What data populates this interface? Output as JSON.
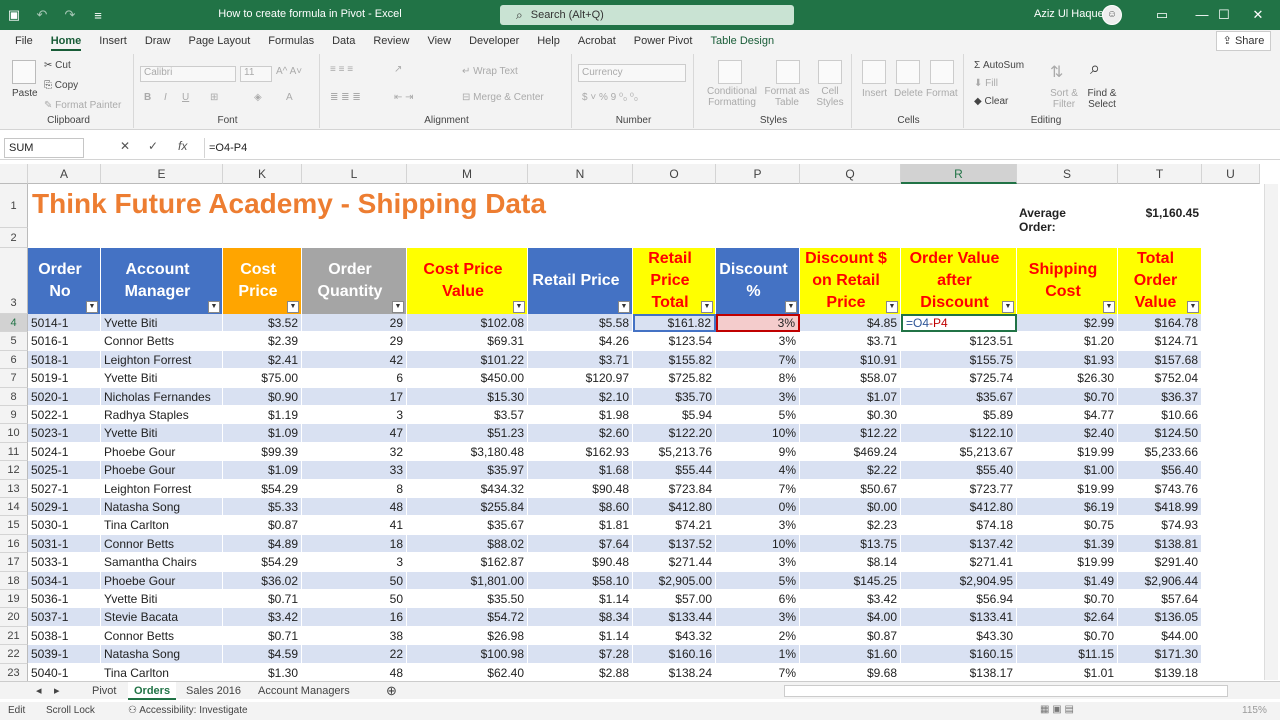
{
  "app": {
    "doc_title": "How to create formula in Pivot  -  Excel",
    "search_placeholder": "Search (Alt+Q)",
    "user_name": "Aziz Ul Haque",
    "share_label": "Share"
  },
  "menu": [
    "File",
    "Home",
    "Insert",
    "Draw",
    "Page Layout",
    "Formulas",
    "Data",
    "Review",
    "View",
    "Developer",
    "Help",
    "Acrobat",
    "Power Pivot",
    "Table Design"
  ],
  "ribbon": {
    "paste": "Paste",
    "cut": "Cut",
    "copy": "Copy",
    "format_painter": "Format Painter",
    "clipboard": "Clipboard",
    "font_name": "Calibri",
    "font_size": "11",
    "font": "Font",
    "wrap_text": "Wrap Text",
    "merge_center": "Merge & Center",
    "alignment": "Alignment",
    "number_format": "Currency",
    "number": "Number",
    "cond_fmt": "Conditional Formatting",
    "format_table": "Format as Table",
    "cell_styles": "Cell Styles",
    "styles": "Styles",
    "insert": "Insert",
    "delete": "Delete",
    "format": "Format",
    "cells": "Cells",
    "autosum": "AutoSum",
    "fill": "Fill",
    "clear": "Clear",
    "sort_filter": "Sort & Filter",
    "find_select": "Find & Select",
    "editing": "Editing"
  },
  "formula_bar": {
    "name_box": "SUM",
    "formula": "=O4-P4"
  },
  "columns": [
    "A",
    "E",
    "K",
    "L",
    "M",
    "N",
    "O",
    "P",
    "Q",
    "R",
    "S",
    "T",
    "U"
  ],
  "sheet": {
    "title": "Think Future Academy - Shipping Data",
    "avg_label": "Average Order:",
    "avg_value": "$1,160.45",
    "headers": [
      "Order No",
      "Account Manager",
      "Cost Price",
      "Order Quantity",
      "Cost Price Value",
      "Retail Price",
      "Retail Price Total",
      "Discount %",
      "Discount $ on Retail Price",
      "Order Value after Discount",
      "Shipping Cost",
      "Total Order Value"
    ],
    "editing_cell": "=O4-P4",
    "rows": [
      [
        "5014-1",
        "Yvette Biti",
        "$3.52",
        "29",
        "$102.08",
        "$5.58",
        "$161.82",
        "3%",
        "$4.85",
        "",
        "$2.99",
        "$164.78"
      ],
      [
        "5016-1",
        "Connor Betts",
        "$2.39",
        "29",
        "$69.31",
        "$4.26",
        "$123.54",
        "3%",
        "$3.71",
        "$123.51",
        "$1.20",
        "$124.71"
      ],
      [
        "5018-1",
        "Leighton Forrest",
        "$2.41",
        "42",
        "$101.22",
        "$3.71",
        "$155.82",
        "7%",
        "$10.91",
        "$155.75",
        "$1.93",
        "$157.68"
      ],
      [
        "5019-1",
        "Yvette Biti",
        "$75.00",
        "6",
        "$450.00",
        "$120.97",
        "$725.82",
        "8%",
        "$58.07",
        "$725.74",
        "$26.30",
        "$752.04"
      ],
      [
        "5020-1",
        "Nicholas Fernandes",
        "$0.90",
        "17",
        "$15.30",
        "$2.10",
        "$35.70",
        "3%",
        "$1.07",
        "$35.67",
        "$0.70",
        "$36.37"
      ],
      [
        "5022-1",
        "Radhya Staples",
        "$1.19",
        "3",
        "$3.57",
        "$1.98",
        "$5.94",
        "5%",
        "$0.30",
        "$5.89",
        "$4.77",
        "$10.66"
      ],
      [
        "5023-1",
        "Yvette Biti",
        "$1.09",
        "47",
        "$51.23",
        "$2.60",
        "$122.20",
        "10%",
        "$12.22",
        "$122.10",
        "$2.40",
        "$124.50"
      ],
      [
        "5024-1",
        "Phoebe Gour",
        "$99.39",
        "32",
        "$3,180.48",
        "$162.93",
        "$5,213.76",
        "9%",
        "$469.24",
        "$5,213.67",
        "$19.99",
        "$5,233.66"
      ],
      [
        "5025-1",
        "Phoebe Gour",
        "$1.09",
        "33",
        "$35.97",
        "$1.68",
        "$55.44",
        "4%",
        "$2.22",
        "$55.40",
        "$1.00",
        "$56.40"
      ],
      [
        "5027-1",
        "Leighton Forrest",
        "$54.29",
        "8",
        "$434.32",
        "$90.48",
        "$723.84",
        "7%",
        "$50.67",
        "$723.77",
        "$19.99",
        "$743.76"
      ],
      [
        "5029-1",
        "Natasha Song",
        "$5.33",
        "48",
        "$255.84",
        "$8.60",
        "$412.80",
        "0%",
        "$0.00",
        "$412.80",
        "$6.19",
        "$418.99"
      ],
      [
        "5030-1",
        "Tina Carlton",
        "$0.87",
        "41",
        "$35.67",
        "$1.81",
        "$74.21",
        "3%",
        "$2.23",
        "$74.18",
        "$0.75",
        "$74.93"
      ],
      [
        "5031-1",
        "Connor Betts",
        "$4.89",
        "18",
        "$88.02",
        "$7.64",
        "$137.52",
        "10%",
        "$13.75",
        "$137.42",
        "$1.39",
        "$138.81"
      ],
      [
        "5033-1",
        "Samantha Chairs",
        "$54.29",
        "3",
        "$162.87",
        "$90.48",
        "$271.44",
        "3%",
        "$8.14",
        "$271.41",
        "$19.99",
        "$291.40"
      ],
      [
        "5034-1",
        "Phoebe Gour",
        "$36.02",
        "50",
        "$1,801.00",
        "$58.10",
        "$2,905.00",
        "5%",
        "$145.25",
        "$2,904.95",
        "$1.49",
        "$2,906.44"
      ],
      [
        "5036-1",
        "Yvette Biti",
        "$0.71",
        "50",
        "$35.50",
        "$1.14",
        "$57.00",
        "6%",
        "$3.42",
        "$56.94",
        "$0.70",
        "$57.64"
      ],
      [
        "5037-1",
        "Stevie Bacata",
        "$3.42",
        "16",
        "$54.72",
        "$8.34",
        "$133.44",
        "3%",
        "$4.00",
        "$133.41",
        "$2.64",
        "$136.05"
      ],
      [
        "5038-1",
        "Connor Betts",
        "$0.71",
        "38",
        "$26.98",
        "$1.14",
        "$43.32",
        "2%",
        "$0.87",
        "$43.30",
        "$0.70",
        "$44.00"
      ],
      [
        "5039-1",
        "Natasha Song",
        "$4.59",
        "22",
        "$100.98",
        "$7.28",
        "$160.16",
        "1%",
        "$1.60",
        "$160.15",
        "$11.15",
        "$171.30"
      ],
      [
        "5040-1",
        "Tina Carlton",
        "$1.30",
        "48",
        "$62.40",
        "$2.88",
        "$138.24",
        "7%",
        "$9.68",
        "$138.17",
        "$1.01",
        "$139.18"
      ]
    ]
  },
  "tabs": [
    "Pivot",
    "Orders",
    "Sales 2016",
    "Account Managers"
  ],
  "status": {
    "mode": "Edit",
    "scroll_lock": "Scroll Lock",
    "accessibility": "Accessibility: Investigate",
    "zoom": "115%"
  },
  "colors": {
    "green": "#217346",
    "blue": "#4472c4",
    "yellow": "#ffff00",
    "orange": "#ffa500",
    "gray": "#a5a5a5",
    "title_orange": "#ed7d31",
    "band": "#d9e1f2"
  }
}
